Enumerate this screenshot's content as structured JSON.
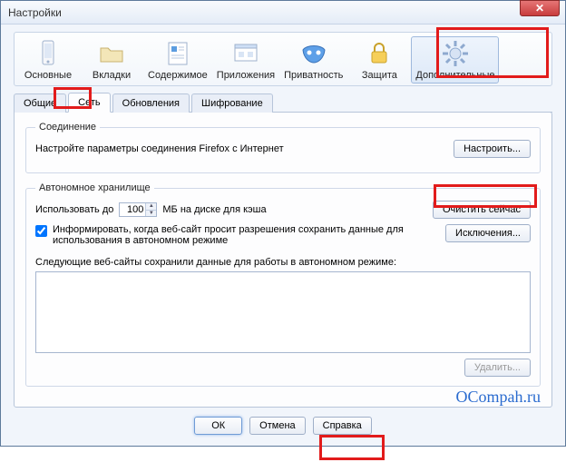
{
  "window": {
    "title": "Настройки"
  },
  "toolbar": {
    "items": [
      {
        "key": "general",
        "label": "Основные"
      },
      {
        "key": "tabs",
        "label": "Вкладки"
      },
      {
        "key": "content",
        "label": "Содержимое"
      },
      {
        "key": "apps",
        "label": "Приложения"
      },
      {
        "key": "privacy",
        "label": "Приватность"
      },
      {
        "key": "security",
        "label": "Защита"
      },
      {
        "key": "advanced",
        "label": "Дополнительные"
      }
    ]
  },
  "tabs": {
    "items": [
      {
        "key": "general",
        "label": "Общие"
      },
      {
        "key": "network",
        "label": "Сеть"
      },
      {
        "key": "updates",
        "label": "Обновления"
      },
      {
        "key": "crypto",
        "label": "Шифрование"
      }
    ]
  },
  "connection": {
    "legend": "Соединение",
    "text": "Настройте параметры соединения Firefox с Интернет",
    "configure": "Настроить..."
  },
  "offline": {
    "legend": "Автономное хранилище",
    "use_up_to": "Использовать до",
    "cache_value": "100",
    "cache_unit": "МБ на диске для кэша",
    "clear_now": "Очистить сейчас",
    "inform_checkbox": "Информировать, когда веб-сайт просит разрешения сохранить данные для использования в автономном режиме",
    "exceptions": "Исключения...",
    "stored_label": "Следующие веб-сайты сохранили данные для работы в автономном режиме:",
    "delete": "Удалить..."
  },
  "footer": {
    "ok": "ОК",
    "cancel": "Отмена",
    "help": "Справка"
  },
  "watermark": "OCompah.ru"
}
